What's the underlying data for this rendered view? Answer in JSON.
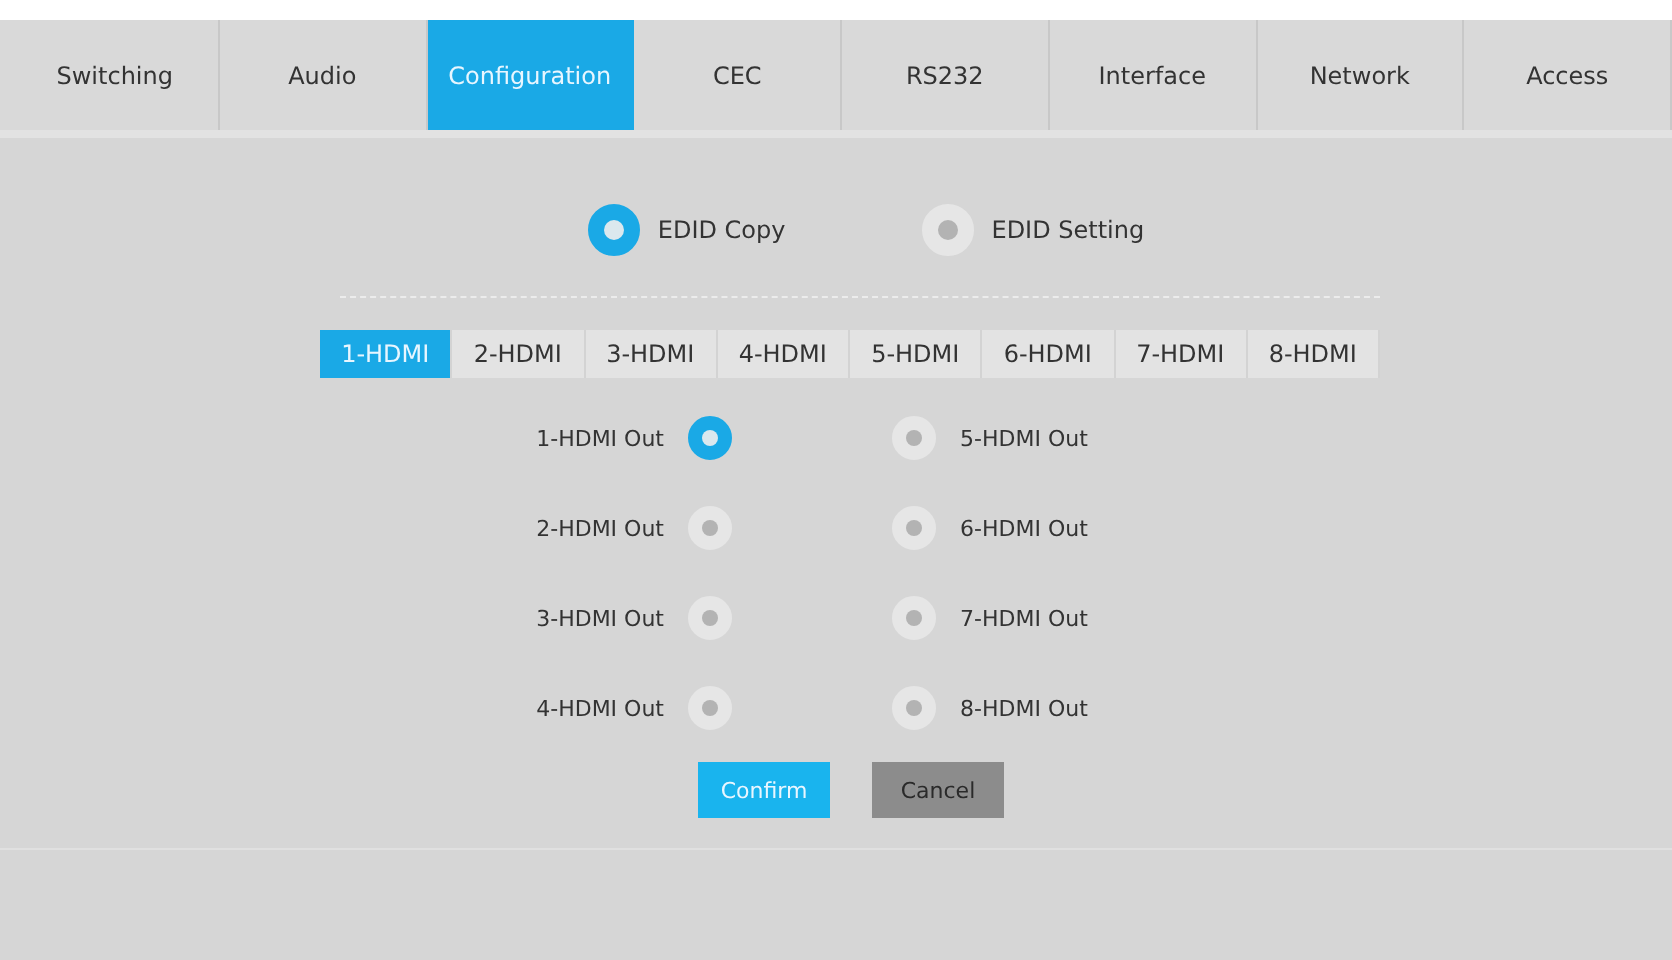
{
  "tabs": [
    {
      "label": "Switching",
      "selected": false
    },
    {
      "label": "Audio",
      "selected": false
    },
    {
      "label": "Configuration",
      "selected": true
    },
    {
      "label": "CEC",
      "selected": false
    },
    {
      "label": "RS232",
      "selected": false
    },
    {
      "label": "Interface",
      "selected": false
    },
    {
      "label": "Network",
      "selected": false
    },
    {
      "label": "Access",
      "selected": false
    }
  ],
  "edid_modes": [
    {
      "label": "EDID Copy",
      "selected": true
    },
    {
      "label": "EDID Setting",
      "selected": false
    }
  ],
  "inputs": [
    {
      "label": "1-HDMI",
      "selected": true
    },
    {
      "label": "2-HDMI",
      "selected": false
    },
    {
      "label": "3-HDMI",
      "selected": false
    },
    {
      "label": "4-HDMI",
      "selected": false
    },
    {
      "label": "5-HDMI",
      "selected": false
    },
    {
      "label": "6-HDMI",
      "selected": false
    },
    {
      "label": "7-HDMI",
      "selected": false
    },
    {
      "label": "8-HDMI",
      "selected": false
    }
  ],
  "outputs": [
    {
      "label": "1-HDMI Out",
      "selected": true
    },
    {
      "label": "2-HDMI Out",
      "selected": false
    },
    {
      "label": "3-HDMI Out",
      "selected": false
    },
    {
      "label": "4-HDMI Out",
      "selected": false
    },
    {
      "label": "5-HDMI Out",
      "selected": false
    },
    {
      "label": "6-HDMI Out",
      "selected": false
    },
    {
      "label": "7-HDMI Out",
      "selected": false
    },
    {
      "label": "8-HDMI Out",
      "selected": false
    }
  ],
  "buttons": [
    {
      "label": "Confirm",
      "kind": "primary"
    },
    {
      "label": "Cancel",
      "kind": "secondary"
    }
  ]
}
